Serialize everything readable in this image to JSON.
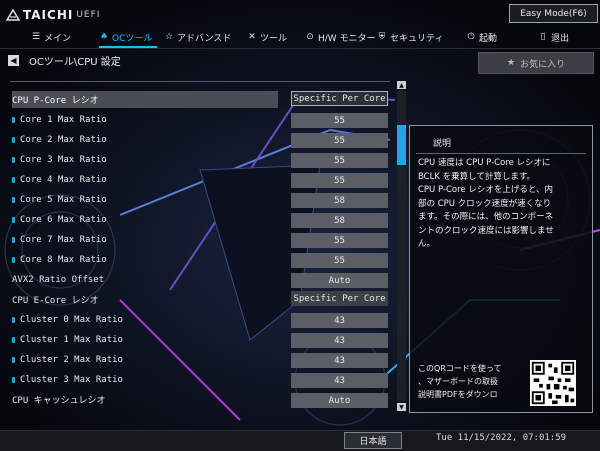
{
  "header": {
    "logo": "TAICHI",
    "logo_sub": "UEFI",
    "easy_mode": "Easy Mode(F6)"
  },
  "tabs": [
    {
      "label": "メイン",
      "icon": "menu-icon"
    },
    {
      "label": "OCツール",
      "icon": "rocket-icon",
      "active": true
    },
    {
      "label": "アドバンスド",
      "icon": "star-icon"
    },
    {
      "label": "ツール",
      "icon": "tools-icon"
    },
    {
      "label": "H/W モニター",
      "icon": "monitor-icon"
    },
    {
      "label": "セキュリティ",
      "icon": "shield-icon"
    },
    {
      "label": "起動",
      "icon": "power-icon"
    },
    {
      "label": "退出",
      "icon": "exit-icon"
    }
  ],
  "breadcrumb": "OCツール\\CPU 設定",
  "favorite_label": "お気に入り",
  "settings": [
    {
      "label": "CPU P-Core レシオ",
      "value": "Specific Per Core",
      "sub": false,
      "selected": true
    },
    {
      "label": "Core 1 Max Ratio",
      "value": "55",
      "sub": true
    },
    {
      "label": "Core 2 Max Ratio",
      "value": "55",
      "sub": true
    },
    {
      "label": "Core 3 Max Ratio",
      "value": "55",
      "sub": true
    },
    {
      "label": "Core 4 Max Ratio",
      "value": "55",
      "sub": true
    },
    {
      "label": "Core 5 Max Ratio",
      "value": "58",
      "sub": true
    },
    {
      "label": "Core 6 Max Ratio",
      "value": "58",
      "sub": true
    },
    {
      "label": "Core 7 Max Ratio",
      "value": "55",
      "sub": true
    },
    {
      "label": "Core 8 Max Ratio",
      "value": "55",
      "sub": true
    },
    {
      "label": "AVX2 Ratio Offset",
      "value": "Auto",
      "sub": false
    },
    {
      "label": "CPU E-Core レシオ",
      "value": "Specific Per Core",
      "sub": false
    },
    {
      "label": "Cluster 0 Max Ratio",
      "value": "43",
      "sub": true
    },
    {
      "label": "Cluster 1 Max Ratio",
      "value": "43",
      "sub": true
    },
    {
      "label": "Cluster 2 Max Ratio",
      "value": "43",
      "sub": true
    },
    {
      "label": "Cluster 3 Max Ratio",
      "value": "43",
      "sub": true
    },
    {
      "label": "CPU  キャッシュレシオ",
      "value": "Auto",
      "sub": false
    }
  ],
  "description": {
    "title": "説明",
    "body": "CPU 速度は CPU P-Core レシオに\nBCLK を乗算して計算します。\nCPU P-Core レシオを上げると、内\n部の CPU クロック速度が速くなり\nます。その際には、他のコンポーネ\nントのクロック速度には影響しませ\nん。",
    "qr_text": "このQRコードを使って\n、マザーボードの取扱\n説明書PDFをダウンロ"
  },
  "footer": {
    "language": "日本語",
    "datetime": "Tue 11/15/2022, 07:01:59"
  },
  "colors": {
    "accent": "#25b9f1",
    "background": "#07090f",
    "value_box": "#5b5e64"
  }
}
